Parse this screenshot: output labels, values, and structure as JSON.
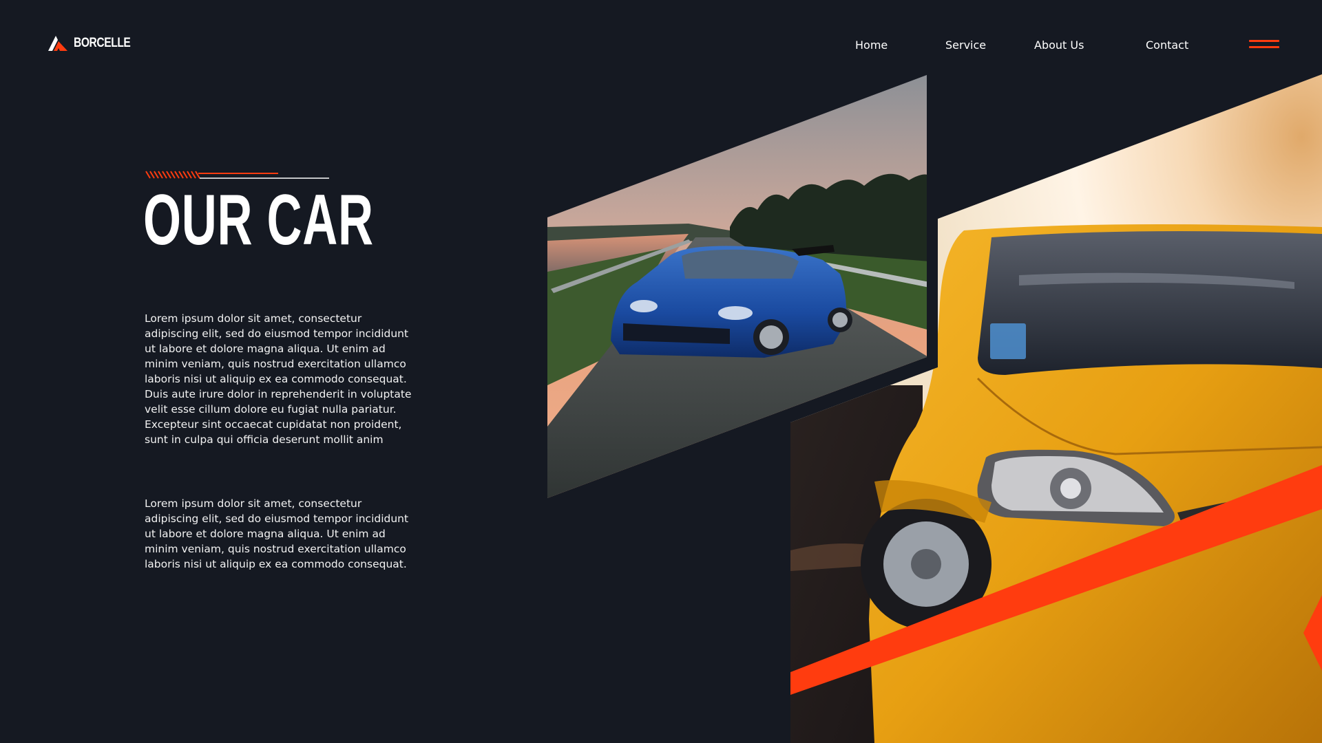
{
  "brand": {
    "name": "BORCELLE",
    "accent_color": "#ff3c0f",
    "icon": "mountain-logo-icon"
  },
  "nav": {
    "items": [
      {
        "label": "Home"
      },
      {
        "label": "Service"
      },
      {
        "label": "About Us"
      },
      {
        "label": "Contact"
      }
    ],
    "menu_icon": "hamburger-menu-icon"
  },
  "hero": {
    "title": "OUR CAR",
    "paragraph_1": "Lorem ipsum dolor sit amet, consectetur adipiscing elit, sed do eiusmod tempor incididunt ut labore et dolore magna aliqua. Ut enim ad minim veniam, quis nostrud exercitation ullamco laboris nisi ut aliquip ex ea commodo consequat. Duis aute irure dolor in reprehenderit in voluptate velit esse cillum dolore eu fugiat nulla pariatur. Excepteur sint occaecat cupidatat non proident, sunt in culpa qui officia deserunt mollit anim",
    "paragraph_2": "Lorem ipsum dolor sit amet, consectetur adipiscing elit, sed do eiusmod tempor incididunt ut labore et dolore magna aliqua. Ut enim ad minim veniam, quis nostrud exercitation ullamco laboris nisi ut aliquip ex ea commodo consequat."
  },
  "images": {
    "photo_1": "blue sports car on road at sunset",
    "photo_2": "yellow car front headlight close-up"
  },
  "colors": {
    "background": "#151922",
    "accent": "#ff3c0f",
    "text": "#ffffff"
  }
}
